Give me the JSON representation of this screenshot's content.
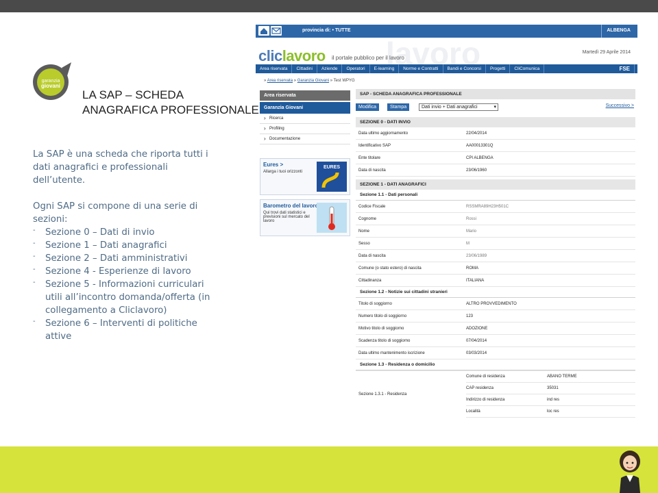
{
  "slide": {
    "title_line1": "LA SAP – SCHEDA",
    "title_line2": "ANAGRAFICA PROFESSIONALE",
    "logo_text_line1": "garanzia",
    "logo_text_line2": "giovani",
    "intro": "La SAP è una scheda che riporta tutti i dati anagrafici e professionali dell’utente.",
    "list_intro": "Ogni SAP si compone di una serie di sezioni:",
    "bullets": [
      "Sezione 0 – Dati di invio",
      "Sezione 1 – Dati anagrafici",
      "Sezione 2 – Dati amministrativi",
      "Sezione 4 - Esperienze di lavoro",
      "Sezione 5 - Informazioni curriculari utili all’incontro domanda/offerta (in collegamento a Cliclavoro)",
      "Sezione 6 – Interventi di politiche attive"
    ],
    "colors": {
      "top_band": "#4a4a4a",
      "bottom_band": "#d5e33a",
      "text": "#4f6b86"
    }
  },
  "portal": {
    "topbar": {
      "province_label": "provincia di: • TUTTE",
      "city": "ALBENGA"
    },
    "brand": {
      "clic": "clic",
      "lavoro": "lavoro",
      "claim": "il portale pubblico per il lavoro",
      "date": "Martedì 29 Aprile 2014",
      "ghost": "lavoro"
    },
    "nav": [
      "Area riservata",
      "Cittadini",
      "Aziende",
      "Operatori",
      "E-learning",
      "Norme e Contratti",
      "Bandi e Concorsi",
      "Progetti",
      "CliComunica"
    ],
    "nav_logo": "FSE",
    "breadcrumb": {
      "sep": "»",
      "items": [
        "Area riservata",
        "Garanzia Giovani",
        "Test WPYG"
      ]
    },
    "sidebar": {
      "header": "Area riservata",
      "section": "Garanzia Giovani",
      "items": [
        "Ricerca",
        "Profiling",
        "Documentazione"
      ],
      "banner1_title": "Eures >",
      "banner1_text": "Allarga i tuoi orizzonti",
      "banner1_img": "EURES",
      "banner2_title": "Barometro del lavoro >",
      "banner2_text": "Qui trovi dati statistici e previsioni sul mercato del lavoro"
    },
    "main": {
      "panel_title": "SAP - SCHEDA ANAGRAFICA PROFESSIONALE",
      "btn_modifica": "Modifica",
      "btn_stampa": "Stampa",
      "select_value": "Dati invio + Dati anagrafici",
      "next_link": "Successivo >",
      "sec0": "SEZIONE 0 - DATI INVIO",
      "sec0_rows": [
        {
          "k": "Data ultimo aggiornamento",
          "v": "22/04/2014"
        },
        {
          "k": "Identificativo SAP",
          "v": "AA00013301Q"
        },
        {
          "k": "Ente titolare",
          "v": "CPI ALBENGA"
        },
        {
          "k": "Data di nascita",
          "v": "23/06/1960"
        }
      ],
      "sec1": "SEZIONE 1 - DATI ANAGRAFICI",
      "sub11": "Sezione 1.1 - Dati personali",
      "sub11_rows": [
        {
          "k": "Codice Fiscale",
          "v": "RSSMRA89H23H501C"
        },
        {
          "k": "Cognome",
          "v": "Rossi"
        },
        {
          "k": "Nome",
          "v": "Mario"
        },
        {
          "k": "Sesso",
          "v": "M"
        },
        {
          "k": "Data di nascita",
          "v": "23/06/1989"
        },
        {
          "k": "Comune (o stato estero) di nascita",
          "v": "ROMA"
        },
        {
          "k": "Cittadinanza",
          "v": "ITALIANA"
        }
      ],
      "sub12": "Sezione 1.2 - Notizie sui cittadini stranieri",
      "sub12_rows": [
        {
          "k": "Titolo di soggiorno",
          "v": "ALTRO PROVVEDIMENTO"
        },
        {
          "k": "Numero titolo di soggiorno",
          "v": "123"
        },
        {
          "k": "Motivo titolo di soggiorno",
          "v": "ADOZIONE"
        },
        {
          "k": "Scadenza titolo di soggiorno",
          "v": "07/04/2014"
        },
        {
          "k": "Data ultimo mantenimento iscrizione",
          "v": "03/03/2014"
        }
      ],
      "sub13": "Sezione 1.3 - Residenza o domicilio",
      "sub131_label": "Sezione 1.3.1 - Residenza",
      "sub131_rows": [
        {
          "k": "Comune di residenza",
          "v": "ABANO TERME"
        },
        {
          "k": "CAP residenza",
          "v": "35031"
        },
        {
          "k": "Indirizzo di residenza",
          "v": "ind res"
        },
        {
          "k": "Località",
          "v": "loc res"
        }
      ]
    }
  }
}
